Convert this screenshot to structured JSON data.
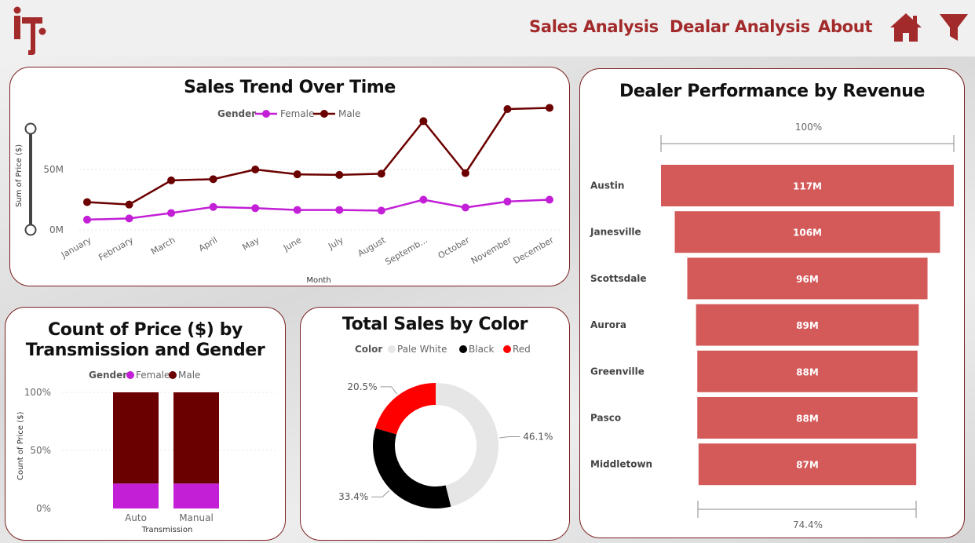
{
  "header": {
    "nav": [
      "Sales Analysis",
      "Dealar Analysis",
      "About"
    ],
    "home_icon": "home-icon",
    "filter_icon": "filter-icon",
    "logo_icon": "company-logo",
    "accent": "#a32a2a"
  },
  "line_chart": {
    "title": "Sales Trend Over Time",
    "legend_title": "Gender",
    "xlabel": "Month",
    "ylabel": "Sum of Price ($)",
    "y_ticks": [
      "50M",
      "0M"
    ],
    "months_display": [
      "January",
      "February",
      "March",
      "April",
      "May",
      "June",
      "July",
      "August",
      "Septemb...",
      "October",
      "November",
      "December"
    ]
  },
  "stacked_chart": {
    "title_line1": "Count of Price ($) by",
    "title_line2": "Transmission and Gender",
    "legend_title": "Gender",
    "xlabel": "Transmission",
    "ylabel": "Count of Price ($)",
    "y_ticks": [
      "100%",
      "50%",
      "0%"
    ]
  },
  "donut_chart": {
    "title": "Total Sales by Color",
    "legend_title": "Color",
    "labels_pct": [
      "46.1%",
      "33.4%",
      "20.5%"
    ]
  },
  "funnel_chart": {
    "title": "Dealer Performance by Revenue",
    "top_pct": "100%",
    "bottom_pct": "74.4%"
  },
  "chart_data": [
    {
      "type": "line",
      "title": "Sales Trend Over Time",
      "xlabel": "Month",
      "ylabel": "Sum of Price ($)",
      "categories": [
        "January",
        "February",
        "March",
        "April",
        "May",
        "June",
        "July",
        "August",
        "September",
        "October",
        "November",
        "December"
      ],
      "ylim": [
        0,
        90
      ],
      "y_unit": "M",
      "series": [
        {
          "name": "Female",
          "color": "#c21fd6",
          "values": [
            8.5,
            9.5,
            14,
            19,
            18,
            16.5,
            16.5,
            16,
            25,
            18.5,
            23.5,
            25
          ]
        },
        {
          "name": "Male",
          "color": "#6b0000",
          "values": [
            23,
            21,
            41,
            42,
            50,
            46,
            45.5,
            46.5,
            90,
            47,
            100,
            101
          ]
        }
      ],
      "legend": "top"
    },
    {
      "type": "bar",
      "stacked": "percent",
      "title": "Count of Price ($) by Transmission and Gender",
      "xlabel": "Transmission",
      "ylabel": "Count of Price ($)",
      "categories": [
        "Auto",
        "Manual"
      ],
      "series": [
        {
          "name": "Female",
          "color": "#c21fd6",
          "values": [
            21.5,
            21.5
          ]
        },
        {
          "name": "Male",
          "color": "#6b0000",
          "values": [
            78.5,
            78.5
          ]
        }
      ],
      "ylim": [
        0,
        100
      ],
      "legend": "top"
    },
    {
      "type": "pie",
      "donut": true,
      "title": "Total Sales by Color",
      "legend_title": "Color",
      "slices": [
        {
          "label": "Pale White",
          "value": 46.1,
          "color": "#e6e6e6"
        },
        {
          "label": "Black",
          "value": 33.4,
          "color": "#000000"
        },
        {
          "label": "Red",
          "value": 20.5,
          "color": "#ff0000"
        }
      ],
      "legend": "top"
    },
    {
      "type": "bar",
      "orientation": "funnel",
      "title": "Dealer Performance by Revenue",
      "categories": [
        "Austin",
        "Janesville",
        "Scottsdale",
        "Aurora",
        "Greenville",
        "Pasco",
        "Middletown"
      ],
      "values": [
        117,
        106,
        96,
        89,
        88,
        88,
        87
      ],
      "value_labels": [
        "117M",
        "106M",
        "96M",
        "89M",
        "88M",
        "88M",
        "87M"
      ],
      "color": "#d45a5a"
    }
  ]
}
